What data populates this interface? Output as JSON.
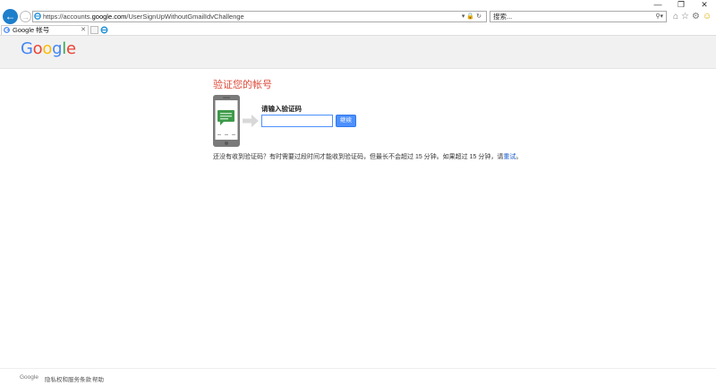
{
  "browser": {
    "address": {
      "prefix": "https://accounts.",
      "domain": "google.com",
      "path": "/UserSignUpWithoutGmailIdvChallenge"
    },
    "search_placeholder": "搜索...",
    "tab_title": "Google 帐号"
  },
  "header": {
    "logo_letters": [
      "G",
      "o",
      "o",
      "g",
      "l",
      "e"
    ]
  },
  "main": {
    "heading": "验证您的帐号",
    "field_label": "请输入验证码",
    "input_value": "",
    "submit_label": "继续",
    "help_text": "还没有收到验证码？有时需要过段时间才能收到验证码，但最长不会超过 15 分钟。如果超过 15 分钟，请",
    "retry_link": "重试",
    "help_end": "。"
  },
  "footer": {
    "brand": "Google",
    "privacy": "隐私权和服务条款",
    "help": "帮助"
  },
  "colors": {
    "heading": "#dd4b39",
    "button": "#4d90fe",
    "back_button": "#1e7fcb"
  }
}
